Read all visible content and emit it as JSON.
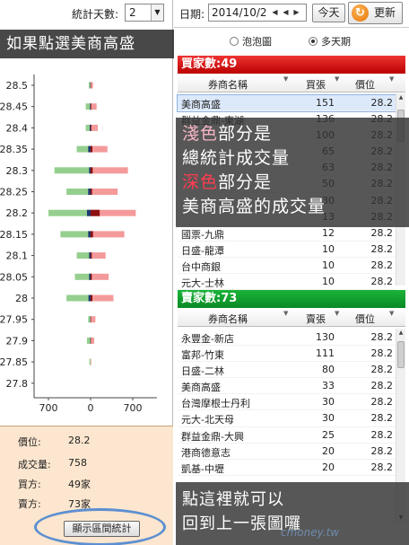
{
  "toolbar": {
    "days_label": "統計天數:",
    "days_value": "2",
    "date_label": "日期:",
    "date_value": "2014/10/2",
    "today_label": "今天",
    "refresh_label": "更新"
  },
  "view_options": [
    {
      "label": "泡泡圖",
      "selected": false
    },
    {
      "label": "多天期",
      "selected": true
    }
  ],
  "annotations": {
    "top": "如果點選美商高盛",
    "mid_line1_a": "淺色",
    "mid_line1_b": "部分是",
    "mid_line2": "總統計成交量",
    "mid_line3_a": "深色",
    "mid_line3_b": "部分是",
    "mid_line4": "美商高盛的成交量",
    "bottom_line1": "點這裡就可以",
    "bottom_line2": "回到上一張圖囉",
    "watermark": "cmoney.tw"
  },
  "info": {
    "price_label": "價位:",
    "price_value": "28.2",
    "volume_label": "成交量:",
    "volume_value": "758",
    "buyers_label": "買方:",
    "buyers_value": "49家",
    "sellers_label": "賣方:",
    "sellers_value": "73家",
    "range_button": "顯示區間統計"
  },
  "colors": {
    "buy_light": "#f49a9a",
    "buy_dark": "#8c1111",
    "sell_light": "#95cf8e",
    "sell_dark": "#1f3a70",
    "buy_header": "#cc1111",
    "sell_header": "#11a02e"
  },
  "chart_data": {
    "type": "bar",
    "orientation": "horizontal-diverging",
    "y": [
      28.5,
      28.45,
      28.4,
      28.35,
      28.3,
      28.25,
      28.2,
      28.15,
      28.1,
      28.05,
      28,
      27.95,
      27.9,
      27.85,
      27.8
    ],
    "y_tick_labels": [
      "28.5",
      "28.45",
      "28.4",
      "28.35",
      "28.3",
      "28.25",
      "28.2",
      "28.15",
      "28.1",
      "28.05",
      "28",
      "27.95",
      "27.9",
      "27.85",
      "27.8"
    ],
    "x_tick_labels": [
      "700",
      "0",
      "700"
    ],
    "xlim": [
      -700,
      700
    ],
    "series": [
      {
        "key": "sell_total",
        "values": [
          -30,
          -80,
          -80,
          -230,
          -600,
          -400,
          -700,
          -500,
          -230,
          -260,
          -400,
          -40,
          -60,
          -20,
          0
        ]
      },
      {
        "key": "buy_total",
        "values": [
          40,
          100,
          120,
          280,
          620,
          450,
          750,
          560,
          250,
          300,
          380,
          80,
          60,
          10,
          0
        ]
      },
      {
        "key": "sell_selected",
        "values": [
          -5,
          -10,
          -15,
          -40,
          -25,
          -40,
          -60,
          -40,
          -25,
          -25,
          -35,
          -5,
          -5,
          0,
          0
        ]
      },
      {
        "key": "buy_selected",
        "values": [
          5,
          10,
          12,
          30,
          35,
          25,
          151,
          40,
          20,
          20,
          30,
          5,
          5,
          0,
          0
        ]
      }
    ],
    "grid": false
  },
  "buyers": {
    "title": "買家數:49",
    "col_name": "券商名稱",
    "col_count": "買張",
    "col_price": "價位",
    "rows": [
      {
        "name": "美商高盛",
        "count": "151",
        "price": "28.2",
        "selected": true
      },
      {
        "name": "群益金鼎-東湖",
        "count": "136",
        "price": "28.2"
      },
      {
        "name": "",
        "count": "100",
        "price": "28.2"
      },
      {
        "name": "",
        "count": "65",
        "price": "28.2"
      },
      {
        "name": "",
        "count": "63",
        "price": "28.2"
      },
      {
        "name": "",
        "count": "50",
        "price": "28.2"
      },
      {
        "name": "",
        "count": "30",
        "price": "28.2"
      },
      {
        "name": "",
        "count": "13",
        "price": "28.2"
      },
      {
        "name": "國票-九鼎",
        "count": "12",
        "price": "28.2"
      },
      {
        "name": "日盛-龍潭",
        "count": "10",
        "price": "28.2"
      },
      {
        "name": "台中商銀",
        "count": "10",
        "price": "28.2"
      },
      {
        "name": "元大-士林",
        "count": "10",
        "price": "28.2"
      }
    ]
  },
  "sellers": {
    "title": "賣家數:73",
    "col_name": "券商名稱",
    "col_count": "賣張",
    "col_price": "價位",
    "rows": [
      {
        "name": "永豐金-新店",
        "count": "130",
        "price": "28.2"
      },
      {
        "name": "富邦-竹東",
        "count": "111",
        "price": "28.2"
      },
      {
        "name": "日盛-二林",
        "count": "80",
        "price": "28.2"
      },
      {
        "name": "美商高盛",
        "count": "33",
        "price": "28.2"
      },
      {
        "name": "台灣摩根士丹利",
        "count": "30",
        "price": "28.2"
      },
      {
        "name": "元大-北天母",
        "count": "30",
        "price": "28.2"
      },
      {
        "name": "群益金鼎-大興",
        "count": "25",
        "price": "28.2"
      },
      {
        "name": "港商德意志",
        "count": "20",
        "price": "28.2"
      },
      {
        "name": "凱基-中壢",
        "count": "20",
        "price": "28.2"
      },
      {
        "name": "",
        "count": "",
        "price": ""
      }
    ]
  }
}
